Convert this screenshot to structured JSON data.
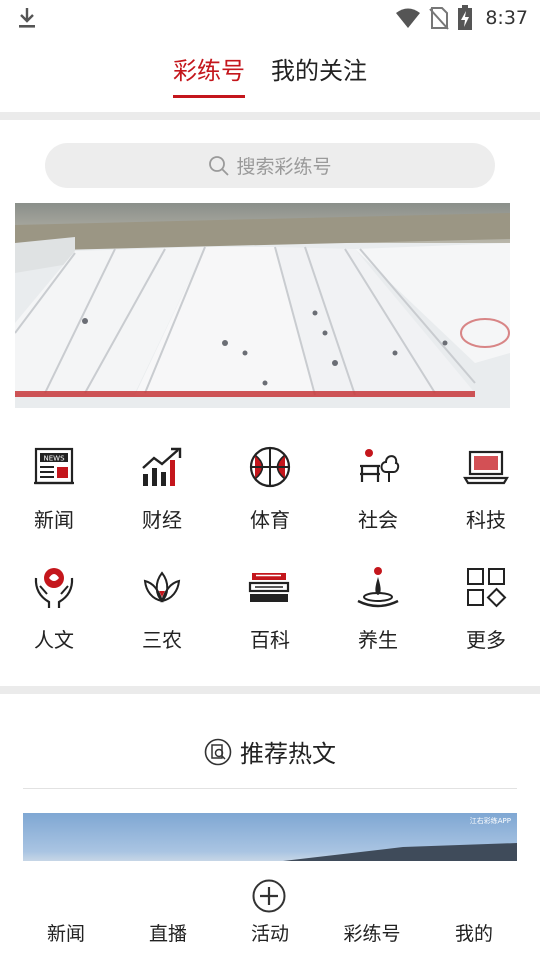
{
  "status_bar": {
    "time": "8:37",
    "icons": [
      "download-icon",
      "wifi-icon",
      "no-sim-icon",
      "battery-charging-icon"
    ]
  },
  "top_tabs": [
    {
      "label": "彩练号",
      "active": true
    },
    {
      "label": "我的关注",
      "active": false
    }
  ],
  "search": {
    "placeholder": "搜索彩练号",
    "icon": "search-icon"
  },
  "banner": {
    "image": "aerial view of snowy ski slope"
  },
  "categories": [
    {
      "label": "新闻",
      "icon": "newspaper-icon"
    },
    {
      "label": "财经",
      "icon": "bar-chart-icon"
    },
    {
      "label": "体育",
      "icon": "basketball-icon"
    },
    {
      "label": "社会",
      "icon": "society-icon"
    },
    {
      "label": "科技",
      "icon": "laptop-icon"
    },
    {
      "label": "人文",
      "icon": "culture-hands-icon"
    },
    {
      "label": "三农",
      "icon": "lotus-icon"
    },
    {
      "label": "百科",
      "icon": "books-icon"
    },
    {
      "label": "养生",
      "icon": "water-drop-icon"
    },
    {
      "label": "更多",
      "icon": "grid-more-icon"
    }
  ],
  "recommended": {
    "title": "推荐热文",
    "icon": "recommend-icon",
    "thumb_watermark": "江右彩练APP"
  },
  "bottom_nav": [
    {
      "label": "新闻"
    },
    {
      "label": "直播"
    },
    {
      "label": "活动",
      "icon": "plus-circle-icon"
    },
    {
      "label": "彩练号"
    },
    {
      "label": "我的"
    }
  ],
  "colors": {
    "accent": "#c4161c",
    "search_bg": "#ededed",
    "divider": "#ebebeb"
  }
}
